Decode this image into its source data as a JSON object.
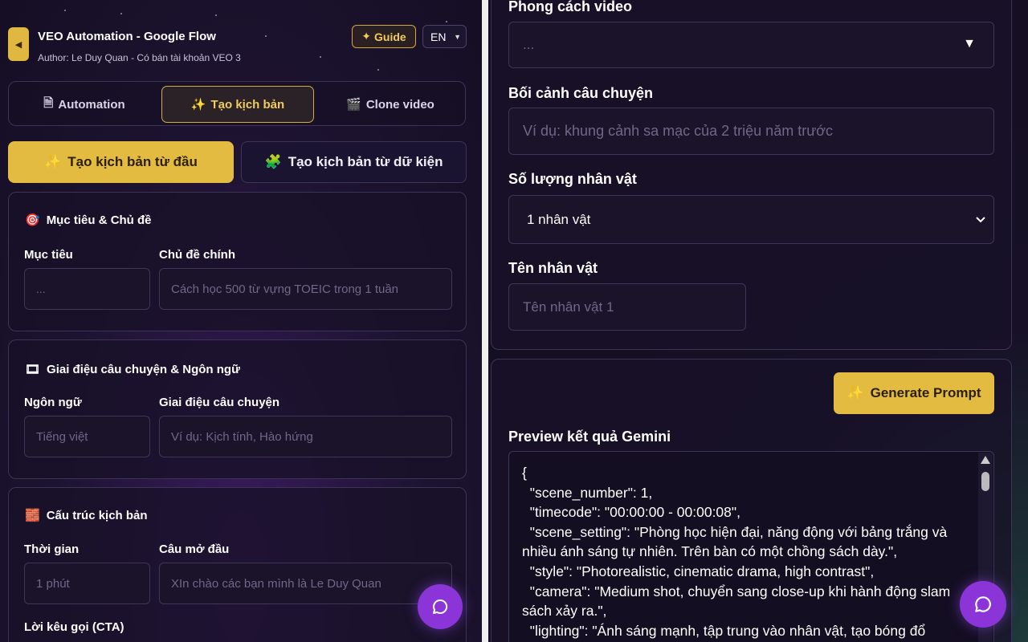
{
  "header": {
    "back_icon": "◀",
    "title": "VEO Automation - Google Flow",
    "author": "Author: Le Duy Quan - Có bán tài khoản VEO 3",
    "guide_label": "Guide",
    "guide_icon": "✦",
    "language": "EN"
  },
  "tabs": [
    {
      "icon": "🗎",
      "label": "Automation"
    },
    {
      "icon": "✨",
      "label": "Tạo kịch bản"
    },
    {
      "icon": "🎬",
      "label": "Clone video"
    }
  ],
  "modes": {
    "primary": {
      "icon": "✨",
      "label": "Tạo kịch bản từ đầu"
    },
    "secondary": {
      "icon": "🧩",
      "label": "Tạo kịch bản từ dữ kiện"
    }
  },
  "sections": {
    "goal": {
      "icon": "🎯",
      "title": "Mục tiêu & Chủ đề",
      "goal_label": "Mục tiêu",
      "goal_value": "...",
      "topic_label": "Chủ đề chính",
      "topic_placeholder": "Cách học 500 từ vựng TOEIC trong 1 tuần"
    },
    "tone": {
      "icon": "🎞",
      "title": "Giai điệu câu chuyện & Ngôn ngữ",
      "language_label": "Ngôn ngữ",
      "language_placeholder": "Tiếng việt",
      "tone_label": "Giai điệu câu chuyện",
      "tone_placeholder": "Ví dụ: Kịch tính, Hào hứng"
    },
    "structure": {
      "icon": "🧱",
      "title": "Cấu trúc kịch bản",
      "time_label": "Thời gian",
      "time_placeholder": "1 phút",
      "opening_label": "Câu mở đầu",
      "opening_placeholder": "XIn chào các bạn mình là Le Duy Quan",
      "cta_label": "Lời kêu gọi (CTA)"
    }
  },
  "right": {
    "style_label": "Phong cách video",
    "style_value": "...",
    "context_label": "Bối cảnh câu chuyện",
    "context_placeholder": "Ví dụ: khung cảnh sa mạc của 2 triệu năm trước",
    "count_label": "Số lượng nhân vật",
    "count_value": "1 nhân vật",
    "name_label": "Tên nhân vật",
    "name_placeholder": "Tên nhân vật 1",
    "generate_icon": "✨",
    "generate_label": "Generate Prompt",
    "preview_label": "Preview kết quả Gemini",
    "preview_text": "{\n  \"scene_number\": 1,\n  \"timecode\": \"00:00:00 - 00:00:08\",\n  \"scene_setting\": \"Phòng học hiện đại, năng động với bảng trắng và nhiều ánh sáng tự nhiên. Trên bàn có một chồng sách dày.\",\n  \"style\": \"Photorealistic, cinematic drama, high contrast\",\n  \"camera\": \"Medium shot, chuyển sang close-up khi hành động slam sách xảy ra.\",\n  \"lighting\": \"Ánh sáng mạnh, tập trung vào nhân vật, tạo bóng đổ"
  },
  "colors": {
    "accent": "#e2bb40",
    "fab": "#8b35d8",
    "panel_bg": "#1d1330"
  }
}
